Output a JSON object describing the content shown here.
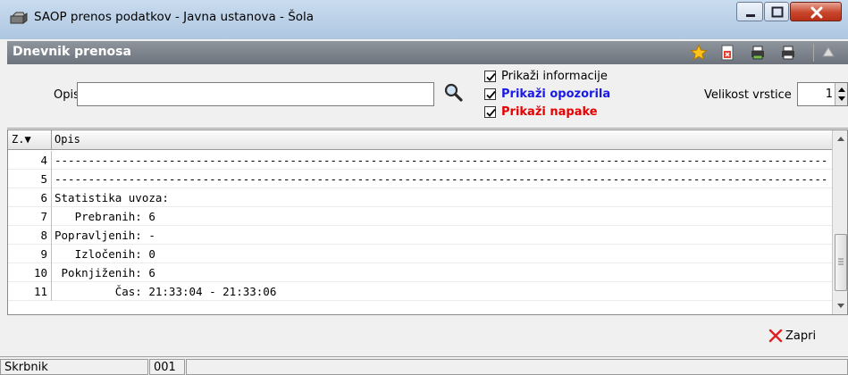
{
  "window": {
    "title": "SAOP prenos podatkov - Javna ustanova - Šola"
  },
  "panel": {
    "title": "Dnevnik prenosa"
  },
  "toolbar": {
    "icons": [
      "star-icon",
      "export-icon",
      "print-setup-icon",
      "print-icon",
      "stamp-icon"
    ]
  },
  "filter": {
    "opis_label": "Opis",
    "opis_value": "",
    "checks": {
      "info": {
        "label": "Prikaži informacije",
        "checked": true
      },
      "warn": {
        "label": "Prikaži opozorila",
        "checked": true,
        "color": "#1a1ae6"
      },
      "err": {
        "label": "Prikaži napake",
        "checked": true,
        "color": "#e60000"
      }
    },
    "row_size_label": "Velikost vrstice",
    "row_size_value": "1"
  },
  "grid": {
    "columns": [
      "Z.▼",
      "Opis"
    ],
    "rows": [
      {
        "n": "4",
        "d": "--------------------------------------------------------------------------------------------------------------------------"
      },
      {
        "n": "5",
        "d": "--------------------------------------------------------------------------------------------------------------------------"
      },
      {
        "n": "6",
        "d": "Statistika uvoza:"
      },
      {
        "n": "7",
        "d": "   Prebranih: 6"
      },
      {
        "n": "8",
        "d": "Popravljenih: -"
      },
      {
        "n": "9",
        "d": "   Izločenih: 0"
      },
      {
        "n": "10",
        "d": " Poknjiženih: 6"
      },
      {
        "n": "11",
        "d": "         Čas: 21:33:04 - 21:33:06"
      }
    ]
  },
  "footer": {
    "close_label": "Zapri"
  },
  "status": {
    "user": "Skrbnik",
    "code": "001",
    "message": ""
  }
}
